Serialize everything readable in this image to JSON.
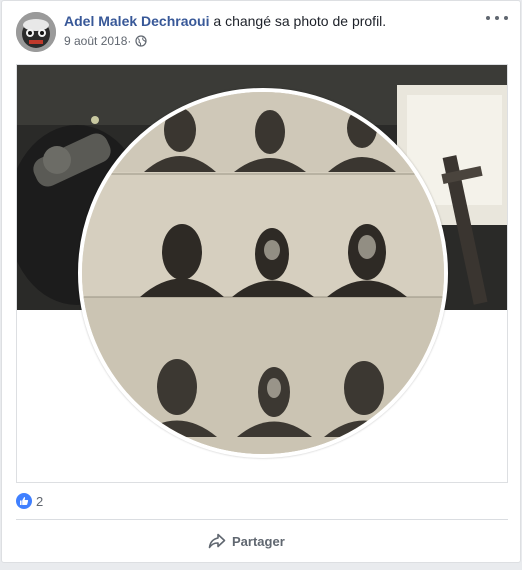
{
  "post": {
    "author": "Adel Malek Dechraoui",
    "action": " a changé sa photo de profil.",
    "date": "9 août 2018",
    "date_separator": " · ",
    "privacy_icon": "globe-icon",
    "menu_icon": "more-options-icon"
  },
  "reactions": {
    "type": "like",
    "count": "2"
  },
  "actions": {
    "share_label": "Partager"
  },
  "colors": {
    "author_link": "#385898",
    "like_badge": "#4080ff",
    "secondary_text": "#616770"
  }
}
